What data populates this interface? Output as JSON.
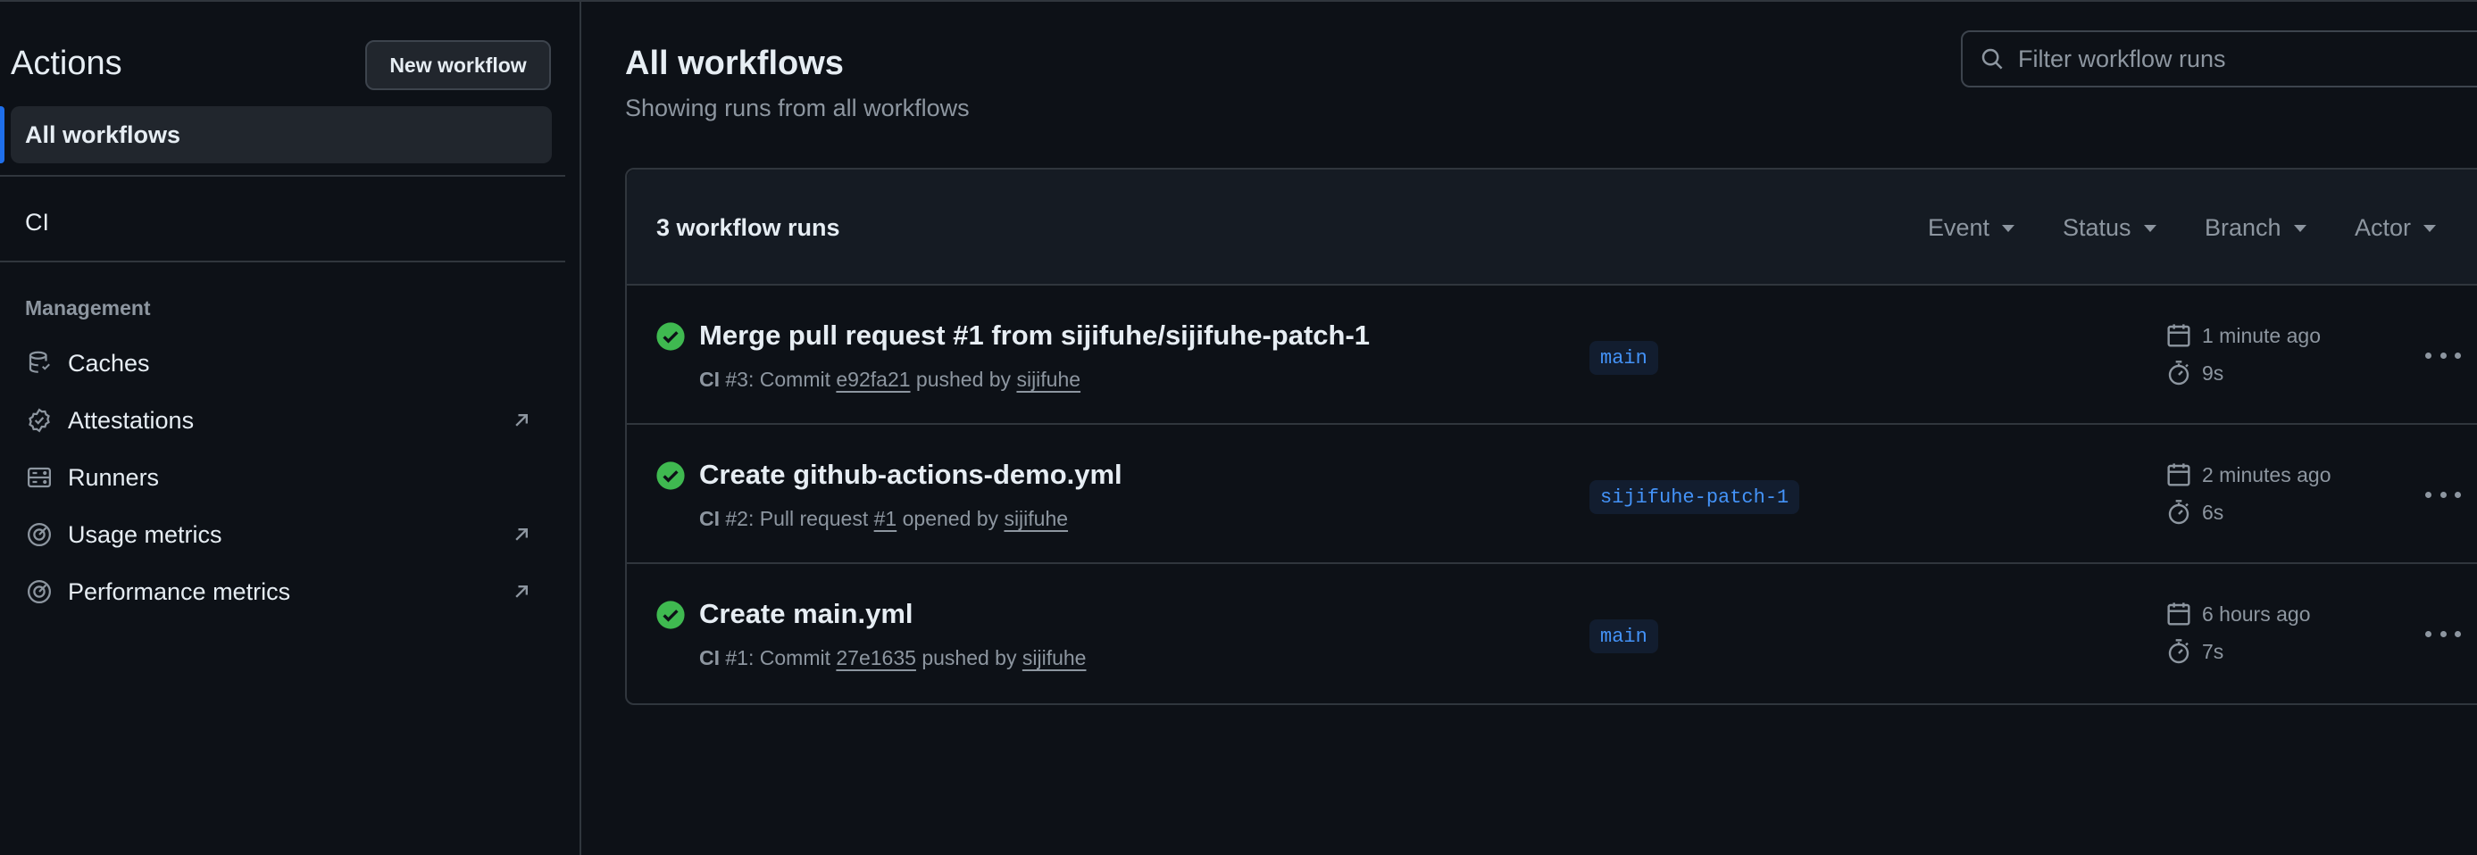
{
  "sidebar": {
    "title": "Actions",
    "new_workflow_label": "New workflow",
    "active_item": "All workflows",
    "workflows": [
      "CI"
    ],
    "section_label": "Management",
    "management_items": [
      {
        "label": "Caches",
        "icon": "database-icon",
        "external": false
      },
      {
        "label": "Attestations",
        "icon": "verified-icon",
        "external": true
      },
      {
        "label": "Runners",
        "icon": "server-icon",
        "external": false
      },
      {
        "label": "Usage metrics",
        "icon": "meter-icon",
        "external": true
      },
      {
        "label": "Performance metrics",
        "icon": "meter-icon",
        "external": true
      }
    ]
  },
  "main": {
    "title": "All workflows",
    "subtitle": "Showing runs from all workflows",
    "filter_placeholder": "Filter workflow runs",
    "run_count": "3 workflow runs",
    "filters": [
      "Event",
      "Status",
      "Branch",
      "Actor"
    ],
    "runs": [
      {
        "title": "Merge pull request #1 from sijifuhe/sijifuhe-patch-1",
        "workflow": "CI",
        "number": "#3",
        "trigger": "Commit",
        "ref": "e92fa21",
        "action": "pushed by",
        "user": "sijifuhe",
        "branch": "main",
        "time": "1 minute ago",
        "duration": "9s",
        "status": "success"
      },
      {
        "title": "Create github-actions-demo.yml",
        "workflow": "CI",
        "number": "#2",
        "trigger": "Pull request",
        "ref": "#1",
        "action": "opened by",
        "user": "sijifuhe",
        "branch": "sijifuhe-patch-1",
        "time": "2 minutes ago",
        "duration": "6s",
        "status": "success"
      },
      {
        "title": "Create main.yml",
        "workflow": "CI",
        "number": "#1",
        "trigger": "Commit",
        "ref": "27e1635",
        "action": "pushed by",
        "user": "sijifuhe",
        "branch": "main",
        "time": "6 hours ago",
        "duration": "7s",
        "status": "success"
      }
    ]
  },
  "colors": {
    "background": "#0d1117",
    "accent": "#1f6feb",
    "success": "#3fb950",
    "muted_text": "#8d96a0",
    "link": "#4493f8"
  }
}
